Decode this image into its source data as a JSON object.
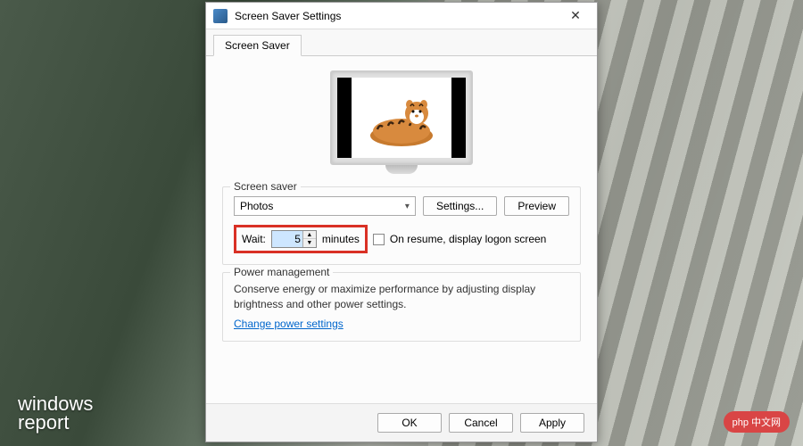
{
  "window": {
    "title": "Screen Saver Settings",
    "tab": "Screen Saver"
  },
  "screensaver": {
    "group_label": "Screen saver",
    "selected": "Photos",
    "settings_btn": "Settings...",
    "preview_btn": "Preview",
    "wait_label": "Wait:",
    "wait_value": "5",
    "wait_unit": "minutes",
    "resume_label": "On resume, display logon screen"
  },
  "power": {
    "group_label": "Power management",
    "desc": "Conserve energy or maximize performance by adjusting display brightness and other power settings.",
    "link": "Change power settings"
  },
  "footer": {
    "ok": "OK",
    "cancel": "Cancel",
    "apply": "Apply"
  },
  "watermark": {
    "brand_line1": "windows",
    "brand_line2": "report",
    "badge": "php 中文网"
  }
}
